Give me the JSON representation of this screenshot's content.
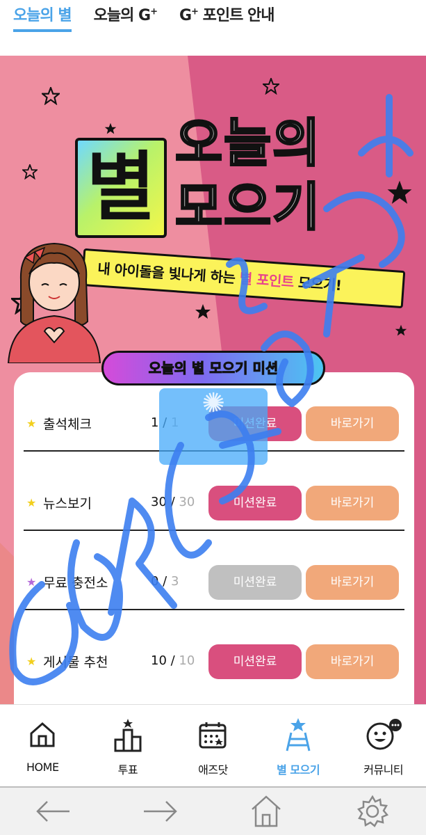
{
  "tabs": [
    {
      "label": "오늘의 별",
      "active": true
    },
    {
      "label": "오늘의 G",
      "sup": "+"
    },
    {
      "label": "G",
      "sup": "+",
      "suffix": " 포인트 안내"
    }
  ],
  "banner": {
    "title_big": "별",
    "title_line1": "오늘의",
    "title_line2": "모으기",
    "ribbon_prefix": "내 아이돌을 빛나게 하는 ",
    "ribbon_highlight": "별 포인트",
    "ribbon_suffix": " 모으기!",
    "mission_title": "오늘의 별 모으기 미션"
  },
  "missions": [
    {
      "name": "출석체크",
      "done": "1",
      "total": "1",
      "status_label": "미션완료",
      "status_color": "#d94f7e",
      "go_label": "바로가기"
    },
    {
      "name": "뉴스보기",
      "done": "30",
      "total": "30",
      "status_label": "미션완료",
      "status_color": "#d94f7e",
      "go_label": "바로가기"
    },
    {
      "name": "무료 충전소",
      "done": "0",
      "total": "3",
      "status_label": "미션완료",
      "status_color": "#c0c0c0",
      "go_label": "바로가기"
    },
    {
      "name": "게시물 추천",
      "done": "10",
      "total": "10",
      "status_label": "미션완료",
      "status_color": "#d94f7e",
      "go_label": "바로가기"
    }
  ],
  "bottom_nav": [
    {
      "label": "HOME",
      "icon": "home-icon"
    },
    {
      "label": "투표",
      "icon": "vote-building-icon"
    },
    {
      "label": "애즈닷",
      "icon": "calendar-icon"
    },
    {
      "label": "별 모으기",
      "icon": "star-ladder-icon",
      "active": true
    },
    {
      "label": "커뮤니티",
      "icon": "smiley-chat-icon"
    }
  ],
  "system_bar": [
    "back-arrow-icon",
    "forward-arrow-icon",
    "home-outline-icon",
    "gear-icon"
  ],
  "colors": {
    "accent": "#4aa3e8",
    "banner_pink": "#ee8ea0",
    "banner_magenta": "#d95b86",
    "mission_done": "#d94f7e",
    "go_button": "#f1a87a",
    "scribble": "#3d7ff0"
  }
}
